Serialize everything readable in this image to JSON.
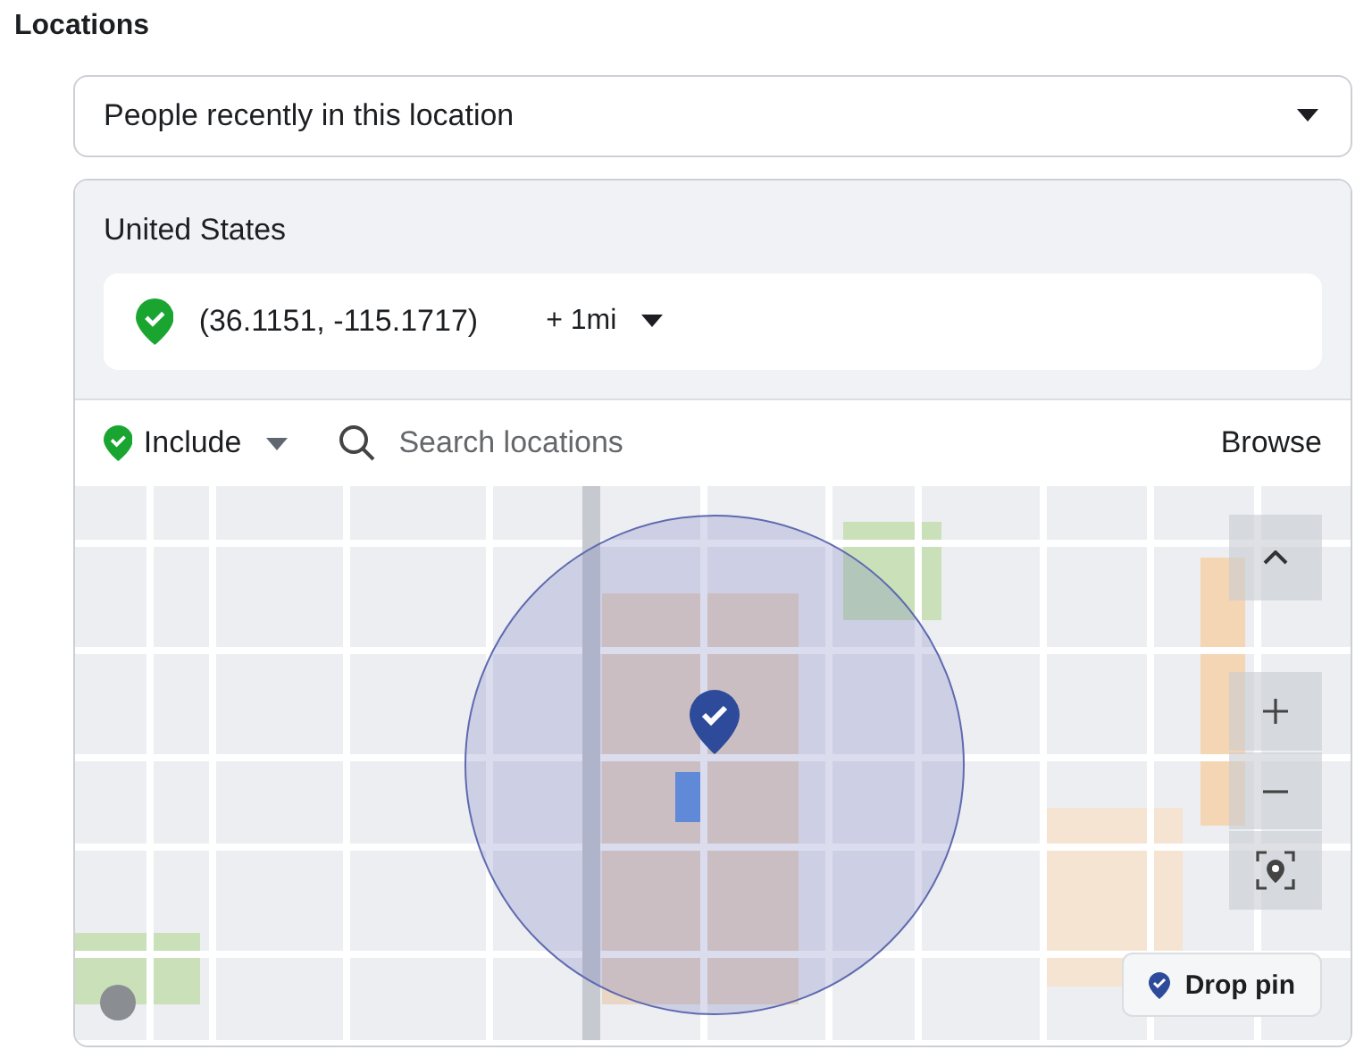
{
  "section_title": "Locations",
  "audience_select": {
    "value": "People recently in this location"
  },
  "location_panel": {
    "country": "United States",
    "location": {
      "coordinates": "(36.1151, -115.1717)",
      "radius": "+ 1mi"
    },
    "toolbar": {
      "mode": "Include",
      "search": {
        "placeholder": "Search locations"
      },
      "browse": "Browse"
    },
    "map": {
      "kind": "picture",
      "drop_pin": "Drop pin"
    }
  }
}
